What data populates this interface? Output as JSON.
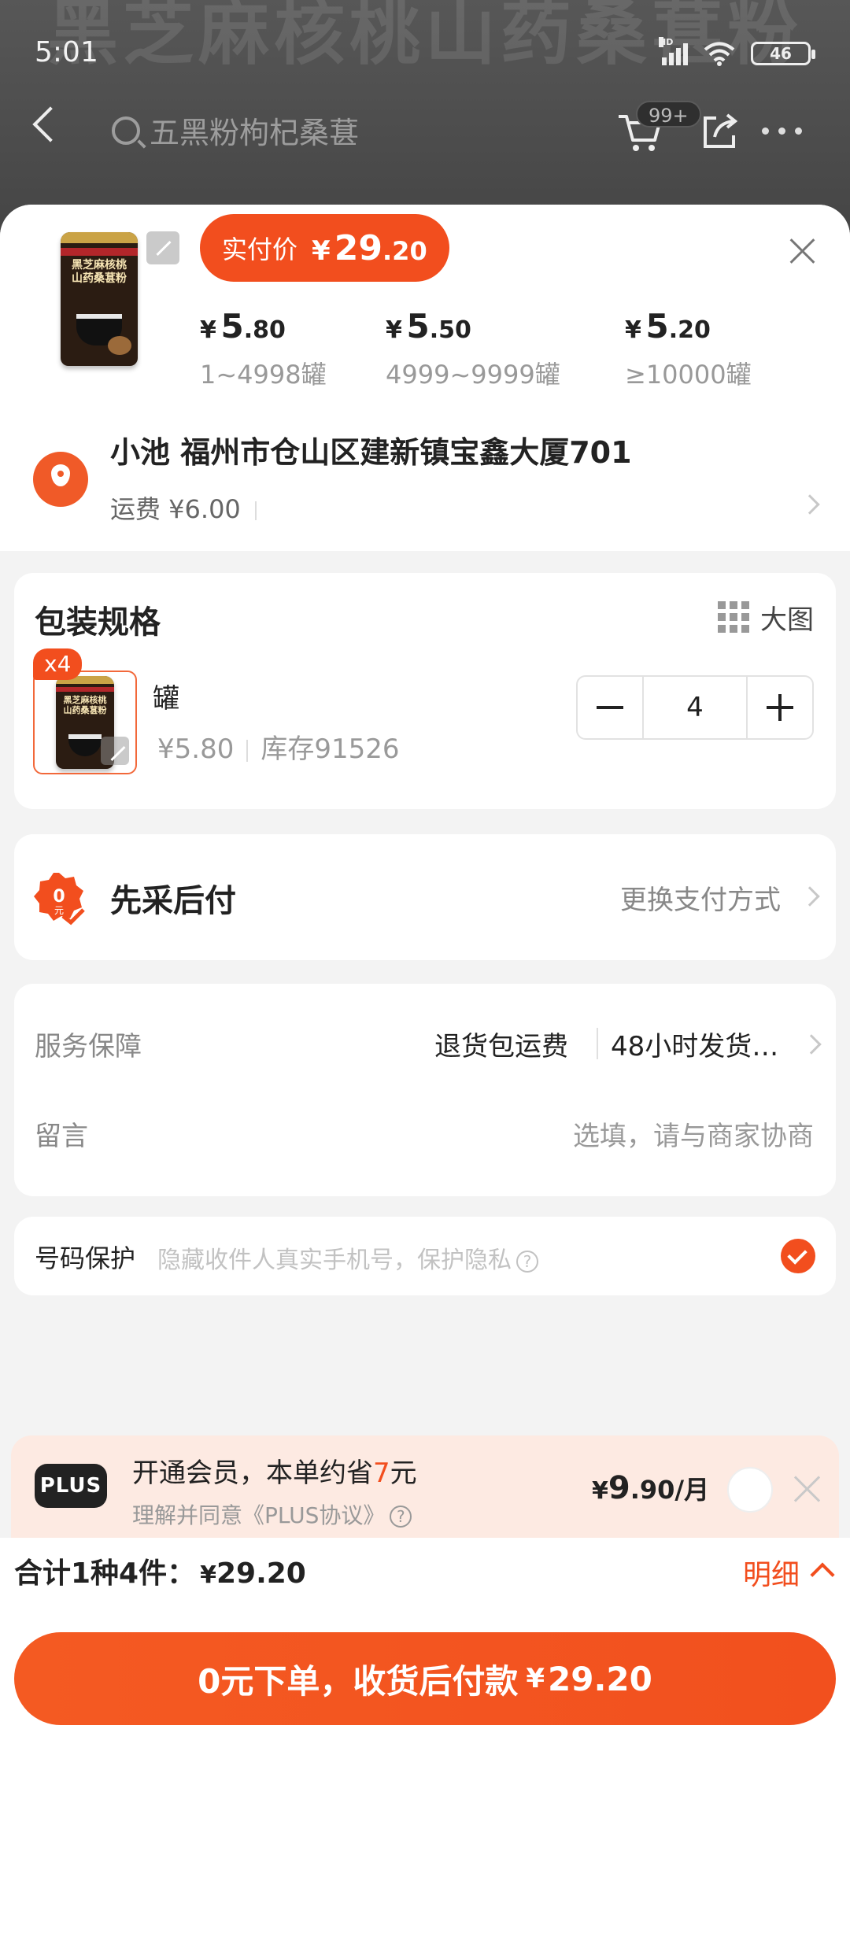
{
  "status_bar": {
    "time": "5:01",
    "battery": "46",
    "network": "HD"
  },
  "background": {
    "banner_text": "黑芝麻核桃山药桑葚粉"
  },
  "nav": {
    "search_text": "五黑粉枸杞桑葚",
    "cart_badge": "99+"
  },
  "product": {
    "price_label": "实付价",
    "price_yen": "¥",
    "price_int": "29",
    "price_dec": ".20",
    "tiers": [
      {
        "yen": "¥",
        "int": "5",
        "dec": ".80",
        "range": "1~4998罐"
      },
      {
        "yen": "¥",
        "int": "5",
        "dec": ".50",
        "range": "4999~9999罐"
      },
      {
        "yen": "¥",
        "int": "5",
        "dec": ".20",
        "range": "≥10000罐"
      }
    ]
  },
  "address": {
    "line": "小池 福州市仓山区建新镇宝鑫大厦701",
    "shipping": "运费 ¥6.00"
  },
  "spec": {
    "title": "包装规格",
    "big_view": "大图",
    "count_badge": "x4",
    "name": "罐",
    "price": "¥5.80",
    "stock": "库存91526",
    "quantity": "4"
  },
  "payment": {
    "label": "先采后付",
    "change": "更换支付方式"
  },
  "service": {
    "label": "服务保障",
    "value1": "退货包运费",
    "value2": "48小时发货…",
    "message_label": "留言",
    "message_placeholder": "选填，请与商家协商"
  },
  "protection": {
    "label": "号码保护",
    "desc": "隐藏收件人真实手机号，保护隐私"
  },
  "plus": {
    "badge": "PLUS",
    "title_pre": "开通会员，本单约省",
    "title_amount": "7",
    "title_post": "元",
    "agreement": "理解并同意《PLUS协议》",
    "price_yen": "¥",
    "price_int": "9",
    "price_dec": ".90/月"
  },
  "footer": {
    "summary": "合计1种4件：",
    "summary_yen": "¥",
    "summary_amount": "29.20",
    "detail": "明细",
    "cta_text": "0元下单，收货后付款",
    "cta_yen": "¥",
    "cta_amount": "29.20"
  },
  "colors": {
    "accent": "#f24e1e",
    "background": "#f3f3f3",
    "card": "#ffffff"
  }
}
